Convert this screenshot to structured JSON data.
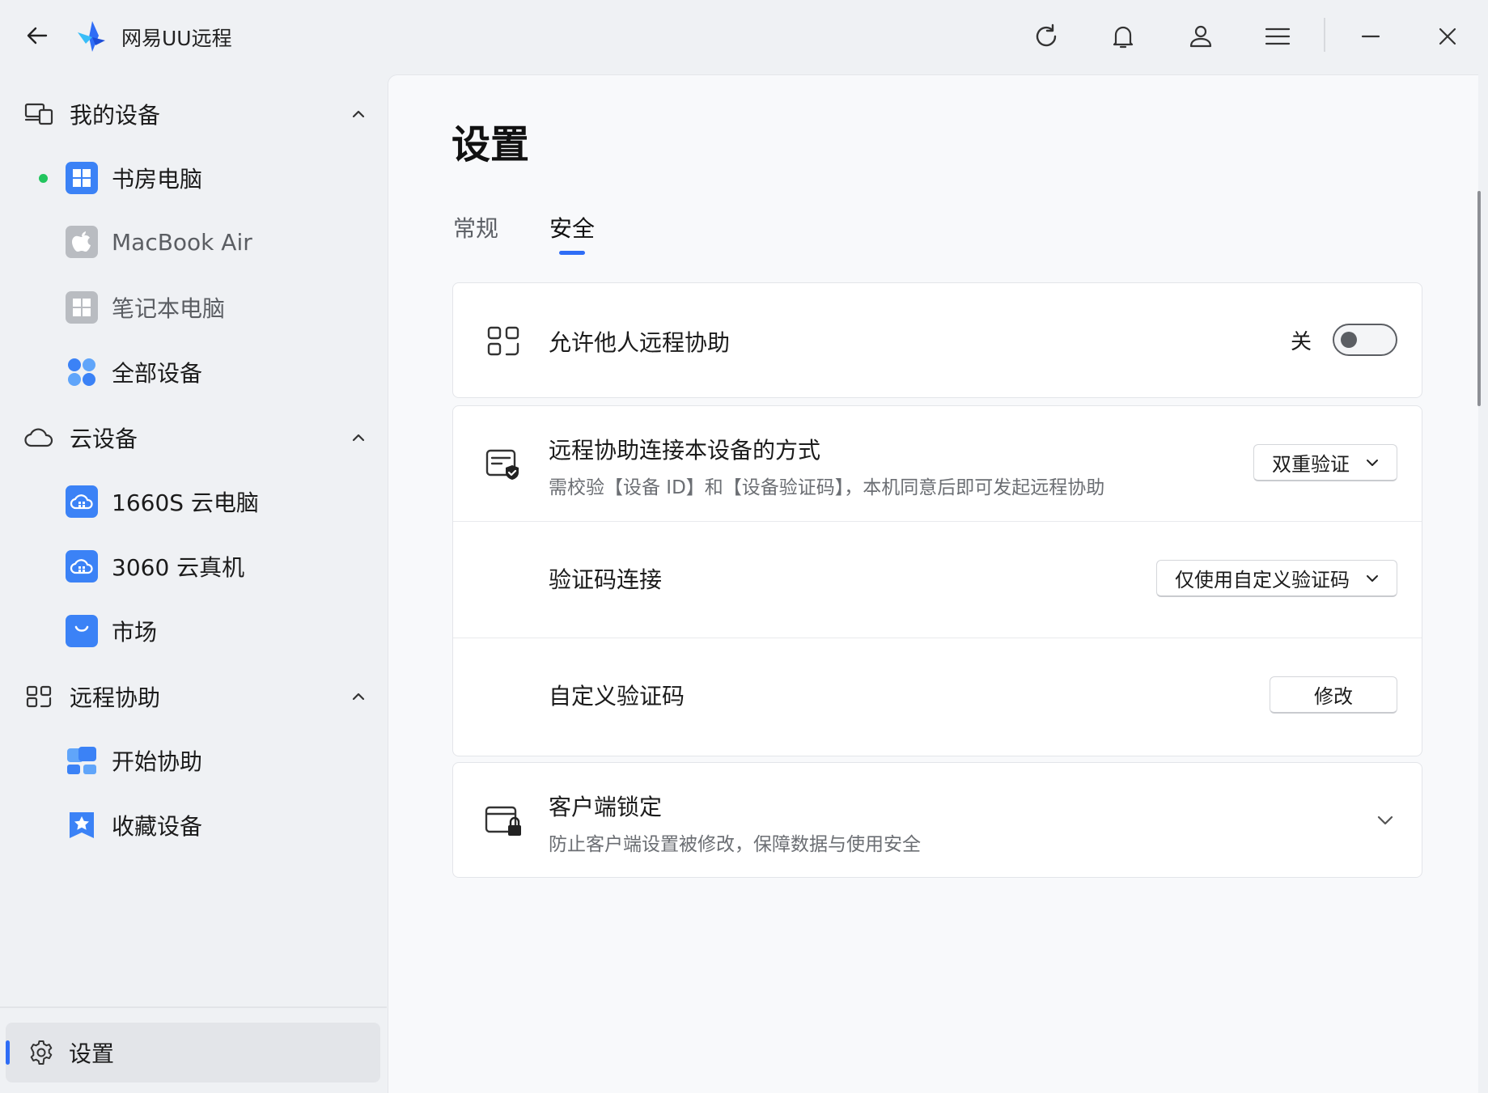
{
  "app": {
    "title": "网易UU远程"
  },
  "titlebar": {
    "icons": [
      "back-arrow-icon",
      "app-logo",
      "refresh-icon",
      "bell-icon",
      "user-icon",
      "menu-icon",
      "minimize-icon",
      "close-icon"
    ]
  },
  "sidebar": {
    "sections": [
      {
        "label": "我的设备",
        "icon": "devices-icon",
        "expanded": true,
        "items": [
          {
            "label": "书房电脑",
            "icon": "windows-icon",
            "online": true
          },
          {
            "label": "MacBook Air",
            "icon": "apple-icon",
            "online": false
          },
          {
            "label": "笔记本电脑",
            "icon": "windows-icon",
            "online": false
          },
          {
            "label": "全部设备",
            "icon": "all-devices-icon"
          }
        ]
      },
      {
        "label": "云设备",
        "icon": "cloud-icon",
        "expanded": true,
        "items": [
          {
            "label": "1660S 云电脑",
            "icon": "cloud-pc-icon"
          },
          {
            "label": "3060 云真机",
            "icon": "cloud-pc-icon"
          },
          {
            "label": "市场",
            "icon": "market-bag-icon"
          }
        ]
      },
      {
        "label": "远程协助",
        "icon": "remote-assist-icon",
        "expanded": true,
        "items": [
          {
            "label": "开始协助",
            "icon": "start-assist-icon"
          },
          {
            "label": "收藏设备",
            "icon": "favorite-devices-icon"
          }
        ]
      }
    ],
    "settings_label": "设置"
  },
  "main": {
    "title": "设置",
    "tabs": [
      {
        "label": "常规",
        "active": false
      },
      {
        "label": "安全",
        "active": true
      }
    ],
    "allow_assist": {
      "title": "允许他人远程协助",
      "toggle_label": "关",
      "enabled": false
    },
    "connect_method": {
      "title": "远程协助连接本设备的方式",
      "desc": "需校验【设备 ID】和【设备验证码】，本机同意后即可发起远程协助",
      "value": "双重验证"
    },
    "code_connect": {
      "title": "验证码连接",
      "value": "仅使用自定义验证码"
    },
    "custom_code": {
      "title": "自定义验证码",
      "button": "修改"
    },
    "client_lock": {
      "title": "客户端锁定",
      "desc": "防止客户端设置被修改，保障数据与使用安全"
    }
  },
  "colors": {
    "accent": "#2f6df6",
    "online": "#22c55e",
    "icon_blue": "#3b82f6",
    "icon_gray": "#b9bcc1"
  }
}
